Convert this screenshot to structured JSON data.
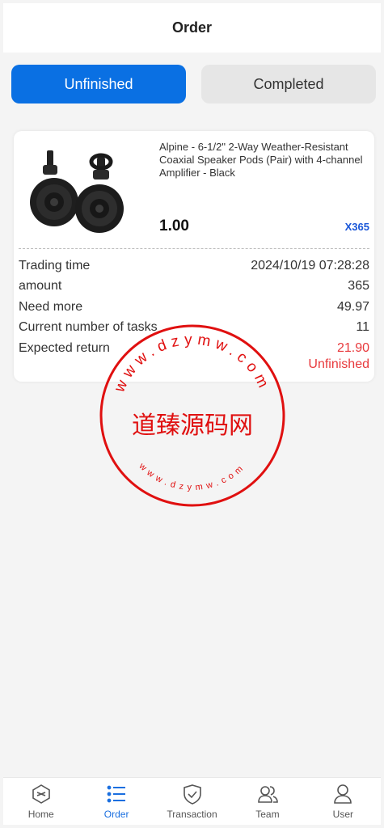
{
  "header": {
    "title": "Order"
  },
  "tabs": {
    "unfinished": "Unfinished",
    "completed": "Completed"
  },
  "order": {
    "product_title": "Alpine - 6-1/2\" 2-Way Weather-Resistant Coaxial Speaker Pods (Pair) with 4-channel Amplifier - Black",
    "price": "1.00",
    "quantity": "X365",
    "rows": [
      {
        "label": "Trading time",
        "value": "2024/10/19 07:28:28"
      },
      {
        "label": "amount",
        "value": "365"
      },
      {
        "label": "Need more",
        "value": "49.97"
      },
      {
        "label": "Current number of tasks",
        "value": "11"
      },
      {
        "label": "Expected return",
        "value": "21.90"
      }
    ],
    "status": "Unfinished"
  },
  "stamp": {
    "center_text": "道臻源码网",
    "ring_text_top": "www.dzymw.com",
    "ring_text_bottom": "www.dzymw.com"
  },
  "tabbar": {
    "items": [
      {
        "label": "Home",
        "icon": "home-icon"
      },
      {
        "label": "Order",
        "icon": "order-list-icon"
      },
      {
        "label": "Transaction",
        "icon": "shield-check-icon"
      },
      {
        "label": "Team",
        "icon": "team-icon"
      },
      {
        "label": "User",
        "icon": "user-icon"
      }
    ]
  },
  "colors": {
    "accent": "#0a70e3",
    "danger": "#e8393c",
    "qty": "#1a57d8",
    "stamp": "#e01010"
  }
}
